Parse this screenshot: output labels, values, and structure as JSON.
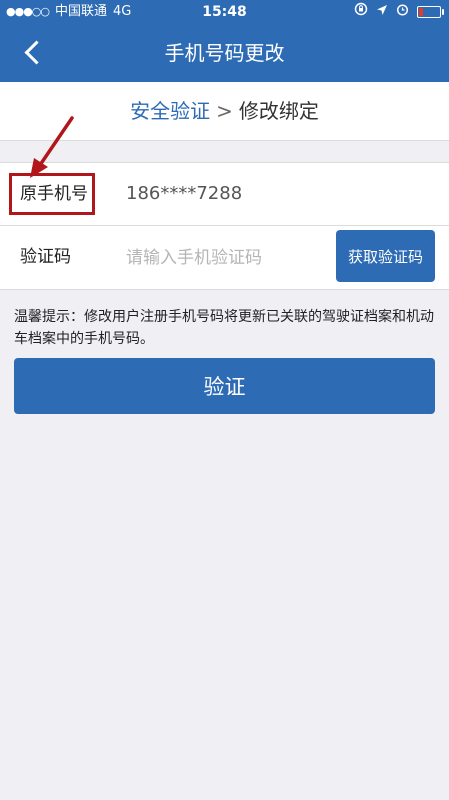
{
  "status": {
    "signal": "●●●○○",
    "carrier": "中国联通",
    "network": "4G",
    "time": "15:48"
  },
  "header": {
    "title": "手机号码更改"
  },
  "steps": {
    "step1": "安全验证",
    "separator": ">",
    "step2": "修改绑定"
  },
  "form": {
    "original_phone_label": "原手机号",
    "original_phone_value": "186****7288",
    "code_label": "验证码",
    "code_placeholder": "请输入手机验证码",
    "get_code_button": "获取验证码"
  },
  "tip": "温馨提示：修改用户注册手机号码将更新已关联的驾驶证档案和机动车档案中的手机号码。",
  "verify_button": "验证",
  "colors": {
    "brand": "#2d6bb4",
    "annotation": "#b1161b"
  }
}
